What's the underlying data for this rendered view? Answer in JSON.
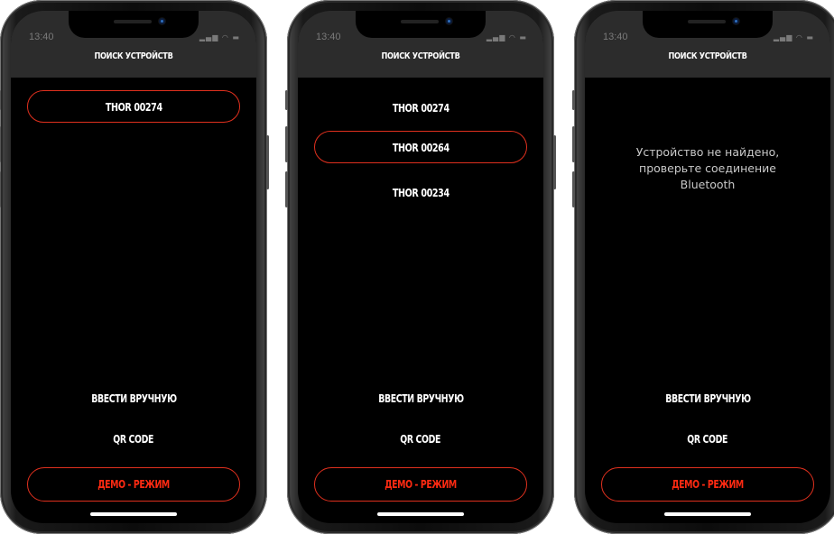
{
  "status_time": "13:40",
  "status_icons": "▂▄▆ ◠ ▬",
  "accent_color": "#e0301e",
  "title": "ПОИСК УСТРОЙСТВ",
  "screen1": {
    "devices": [
      "THOR 00274"
    ]
  },
  "screen2": {
    "devices": [
      "THOR 00274",
      "THOR 00264",
      "THOR 00234"
    ]
  },
  "screen3": {
    "message": "Устройство не найдено,\nпроверьте соединение\nBluetooth"
  },
  "actions": {
    "manual": "ВВЕСТИ ВРУЧНУЮ",
    "qr": "QR CODE",
    "demo": "ДЕМО - РЕЖИМ"
  }
}
